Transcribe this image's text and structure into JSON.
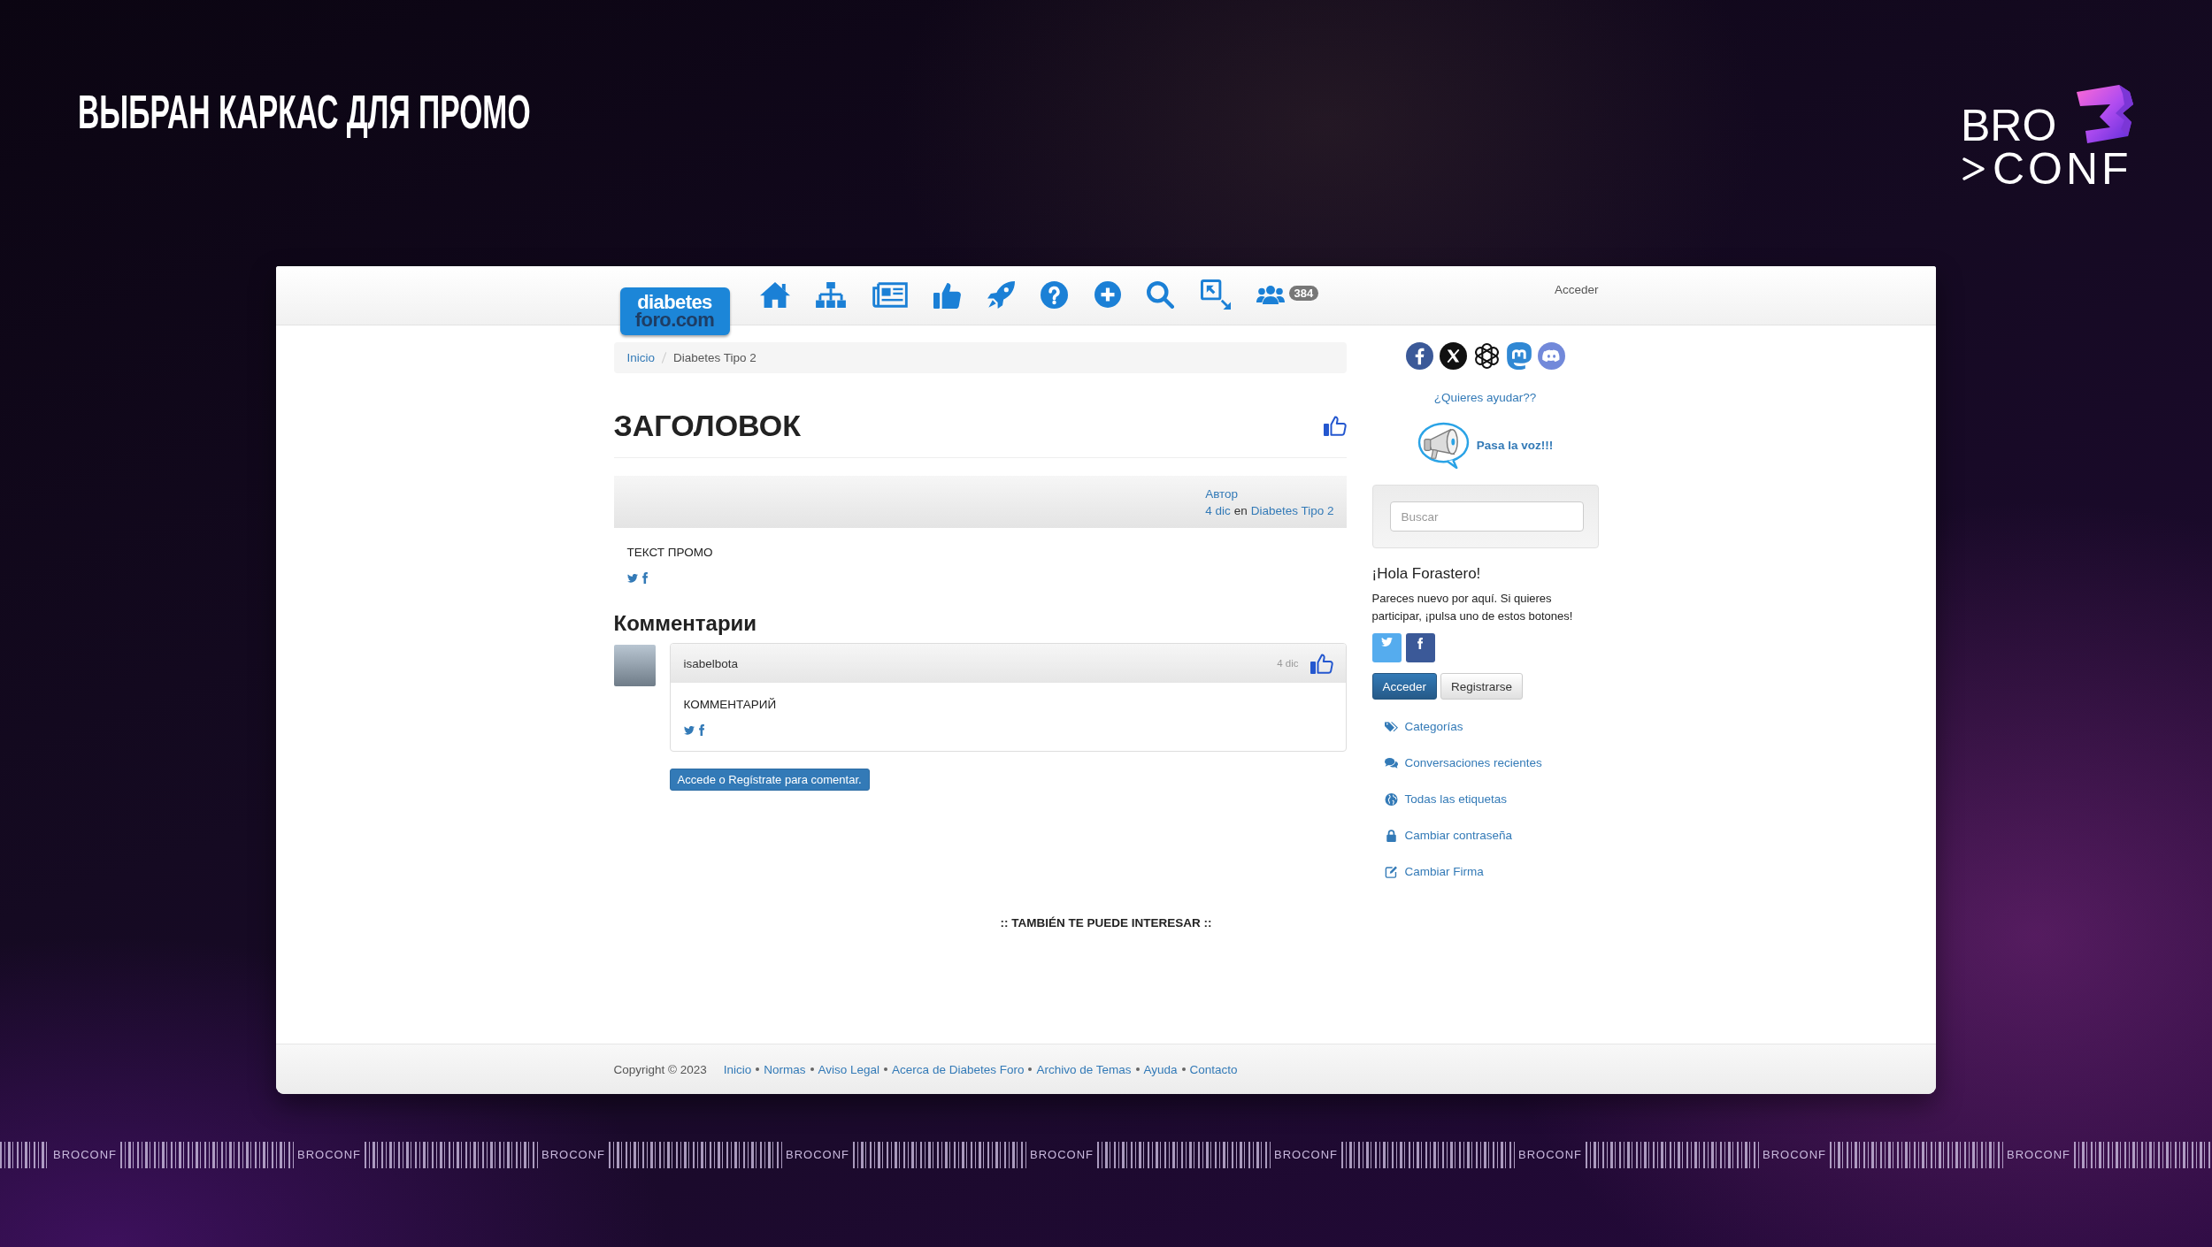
{
  "slide": {
    "title": "ВЫБРАН КАРКАС ДЛЯ ПРОМО"
  },
  "event_logo": {
    "top": "BRO",
    "bottom": "CONF"
  },
  "site": {
    "logo": {
      "top": "diabetes",
      "bottom": "foro.com"
    },
    "nav_badge": "384",
    "login_link": "Acceder",
    "breadcrumb": [
      {
        "label": "Inicio",
        "kind": "link"
      },
      {
        "label": "Diabetes Tipo 2",
        "kind": "current"
      }
    ],
    "post": {
      "title": "ЗАГОЛОВОК",
      "author": "Автор",
      "date": "4 dic",
      "preposition": "en",
      "category": "Diabetes Tipo 2",
      "body": "ТЕКСТ ПРОМО"
    },
    "comments_title": "Комментарии",
    "comments": [
      {
        "user": "isabelbota",
        "date": "4 dic",
        "body": "КОММЕНТАРИЙ"
      }
    ],
    "comment_button": "Accede o Regístrate para comentar.",
    "related_title": ":: TAMBIÉN TE PUEDE INTERESAR ::",
    "sidebar": {
      "help_link": "¿Quieres ayudar??",
      "share_label": "Pasa la voz!!!",
      "search": {
        "placeholder": "Buscar"
      },
      "greeting": "¡Hola Forastero!",
      "intro": "Pareces nuevo por aquí. Si quieres participar, ¡pulsa uno de estos botones!",
      "buttons": [
        {
          "label": "Acceder",
          "kind": "primary"
        },
        {
          "label": "Registrarse",
          "kind": "default"
        }
      ],
      "links": [
        {
          "label": "Categorías"
        },
        {
          "label": "Conversaciones recientes"
        },
        {
          "label": "Todas las etiquetas"
        },
        {
          "label": "Cambiar contraseña"
        },
        {
          "label": "Cambiar Firma"
        }
      ]
    },
    "footer": {
      "copyright": "Copyright © 2023",
      "links": [
        "Inicio",
        "Normas",
        "Aviso Legal",
        "Acerca de Diabetes Foro",
        "Archivo de Temas",
        "Ayuda",
        "Contacto"
      ]
    }
  },
  "ticker": {
    "labels": [
      "BROCONF",
      "BROCONF",
      "BROCONF",
      "BROCONF",
      "BROCONF",
      "BROCONF",
      "BROCONF",
      "BROCONF",
      "BROCONF"
    ]
  }
}
